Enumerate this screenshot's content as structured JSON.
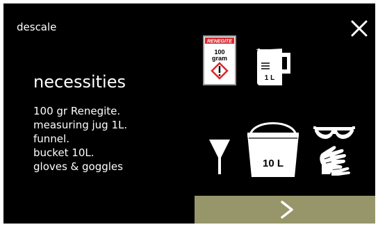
{
  "header": {
    "title": "descale"
  },
  "content": {
    "heading": "necessities",
    "items": [
      "100 gr Renegite.",
      "measuring jug 1L.",
      "funnel.",
      "bucket 10L.",
      "gloves & goggles"
    ]
  },
  "illustrations": {
    "renegite": {
      "brand": "RENEGITE",
      "amount_line1": "100",
      "amount_line2": "gram"
    },
    "jug": {
      "label": "1 L"
    },
    "bucket": {
      "label": "10 L"
    }
  },
  "icons": {
    "close": "close-icon",
    "next": "chevron-right-icon",
    "package": "renegite-package-icon",
    "jug": "measuring-jug-icon",
    "funnel": "funnel-icon",
    "bucket": "bucket-icon",
    "goggles": "goggles-icon",
    "gloves": "gloves-icon"
  },
  "colors": {
    "background": "#000000",
    "text": "#ffffff",
    "next_button": "#97966a",
    "brand_red": "#d7262d"
  }
}
